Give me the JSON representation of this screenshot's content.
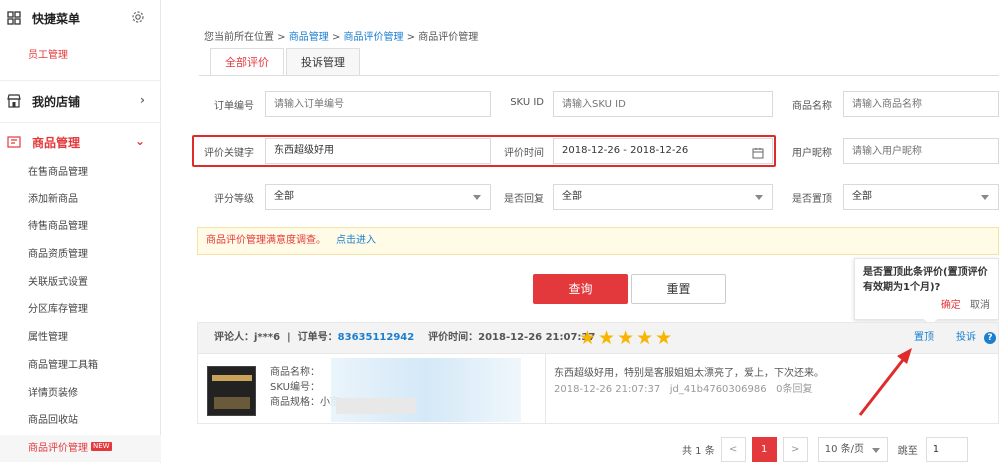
{
  "sidebar": {
    "quick_menu": "快捷菜单",
    "staff": "员工管理",
    "my_store": "我的店铺",
    "goods_mgmt": "商品管理",
    "items": [
      "在售商品管理",
      "添加新商品",
      "待售商品管理",
      "商品资质管理",
      "关联版式设置",
      "分区库存管理",
      "属性管理",
      "商品管理工具箱",
      "详情页装修",
      "商品回收站",
      "商品评价管理"
    ],
    "new_badge": "NEW"
  },
  "breadcrumb": {
    "prefix": "您当前所在位置 >",
    "l1": "商品管理",
    "sep1": ">",
    "l2": "商品评价管理",
    "sep2": ">",
    "current": "商品评价管理"
  },
  "tabs": [
    "全部评价",
    "投诉管理"
  ],
  "form": {
    "order_no_label": "订单编号",
    "order_no_ph": "请输入订单编号",
    "sku_label": "SKU ID",
    "sku_ph": "请输入SKU ID",
    "goods_name_label": "商品名称",
    "goods_name_ph": "请输入商品名称",
    "keyword_label": "评价关键字",
    "keyword_val": "东西超级好用",
    "time_label": "评价时间",
    "time_val": "2018-12-26 - 2018-12-26",
    "nick_label": "用户昵称",
    "nick_ph": "请输入用户昵称",
    "score_label": "评分等级",
    "score_val": "全部",
    "reply_label": "是否回复",
    "reply_val": "全部",
    "pin_label": "是否置顶",
    "pin_val": "全部"
  },
  "notice": {
    "text": "商品评价管理满意度调查。",
    "link": "点击进入"
  },
  "buttons": {
    "query": "查询",
    "reset": "重置"
  },
  "popover": {
    "text": "是否置顶此条评价(置顶评价有效期为1个月)?",
    "ok": "确定",
    "cancel": "取消"
  },
  "review": {
    "reviewer_label": "评论人：",
    "reviewer": "j***6",
    "order_label": "订单号：",
    "order": "83635112942",
    "time_label": "评价时间：",
    "time": "2018-12-26 21:07:37",
    "stars": "★★★★★",
    "rating": 5,
    "pin": "置顶",
    "complain": "投诉",
    "help": "?",
    "product_name": "商品名称：",
    "product_sku": "SKU编号：",
    "product_spec": "商品规格：小京",
    "comment": "东西超级好用，特别是客服姐姐太漂亮了，爱上，下次还来。",
    "meta_time": "2018-12-26 21:07:37",
    "meta_user": "jd_41b4760306986",
    "meta_replies": "0条回复"
  },
  "pager": {
    "total": "共 1 条",
    "prev": "<",
    "page": "1",
    "next": ">",
    "size": "10 条/页",
    "jump_label": "跳至",
    "jump_val": "1"
  },
  "colors": {
    "accent": "#e4393c",
    "link": "#1a7fd1",
    "star": "#f7b500"
  }
}
